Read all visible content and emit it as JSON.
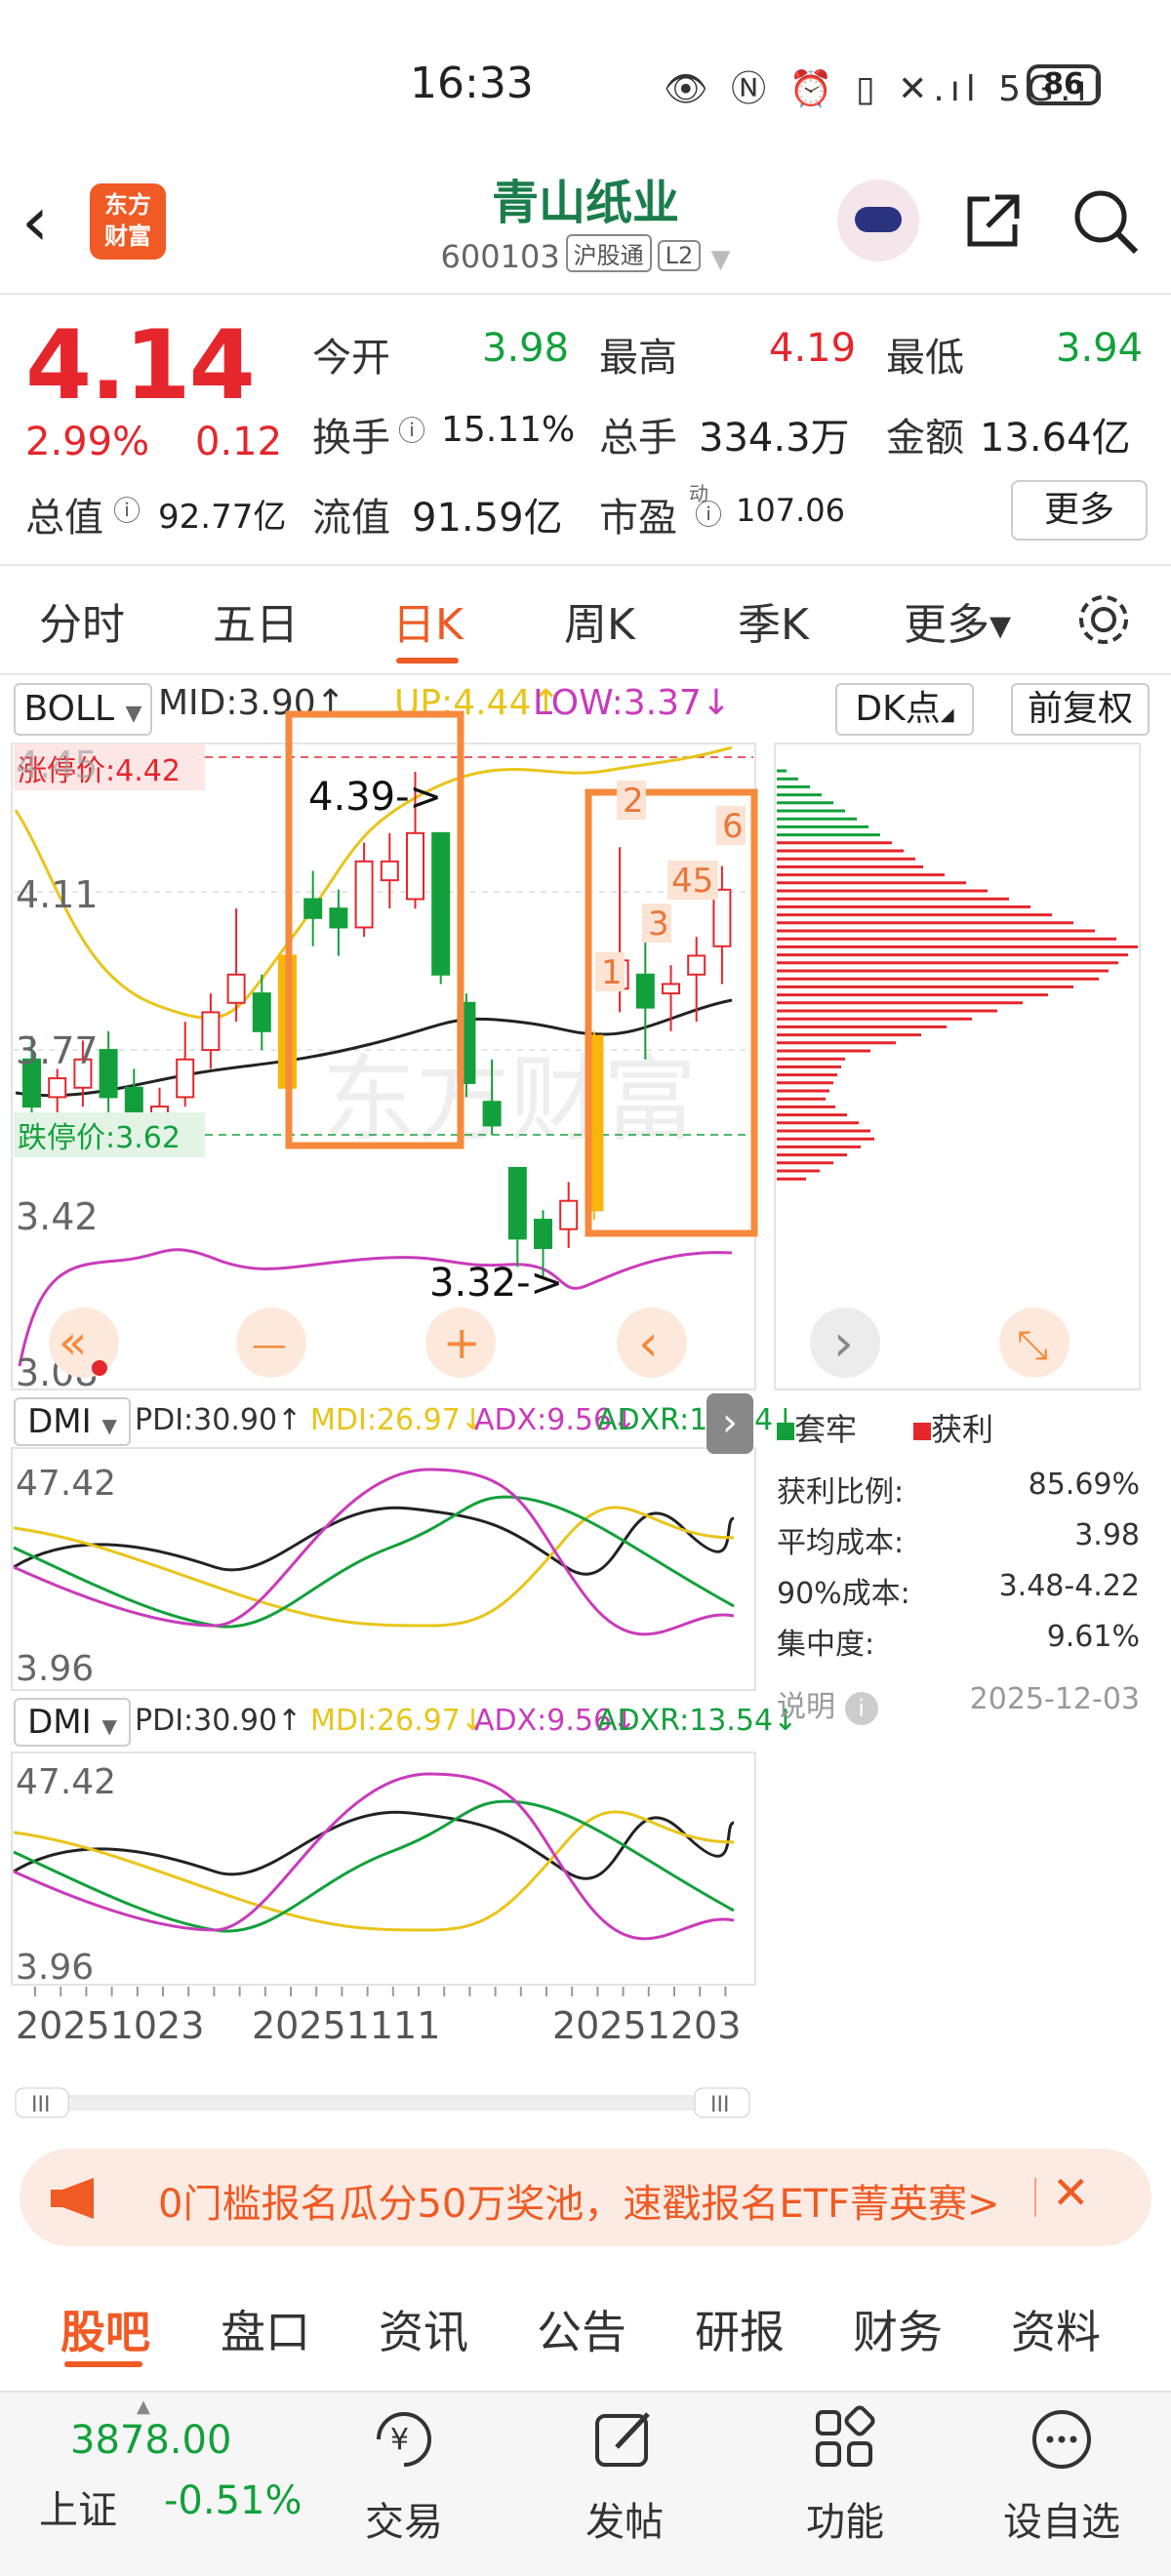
{
  "status_bar": {
    "time": "16:33",
    "battery": "86"
  },
  "header": {
    "logo_line1": "东方",
    "logo_line2": "财富",
    "stock_name": "青山纸业",
    "stock_code": "600103",
    "tag_exchange": "沪股通",
    "tag_level": "L2"
  },
  "quote": {
    "price": "4.14",
    "change_pct": "2.99%",
    "change": "0.12",
    "open_label": "今开",
    "open": "3.98",
    "high_label": "最高",
    "high": "4.19",
    "low_label": "最低",
    "low": "3.94",
    "turnover_label": "换手",
    "turnover": "15.11%",
    "volume_label": "总手",
    "volume": "334.3万",
    "amount_label": "金额",
    "amount": "13.64亿",
    "mktcap_label": "总值",
    "mktcap": "92.77亿",
    "float_label": "流值",
    "float_cap": "91.59亿",
    "pe_label": "市盈",
    "pe_sup": "动",
    "pe": "107.06",
    "more": "更多"
  },
  "period_tabs": [
    "分时",
    "五日",
    "日K",
    "周K",
    "季K",
    "更多▾"
  ],
  "active_period": "日K",
  "main_chart": {
    "indicator": "BOLL",
    "mid": "MID:3.90↑",
    "up": "UP:4.44↑",
    "low": "LOW:3.37↓",
    "dk_button": "DK点",
    "adjust_button": "前复权",
    "limit_up": "涨停价:4.42",
    "limit_down": "跌停价:3.62",
    "y_labels": [
      "4.45",
      "4.11",
      "3.77",
      "3.42",
      "3.08"
    ],
    "annotations": [
      "4.39->",
      "3.32->",
      "1",
      "2",
      "3",
      "45",
      "6"
    ],
    "x_labels": [
      "20251023",
      "20251111",
      "20251203"
    ]
  },
  "chart_data": {
    "type": "candlestick",
    "title": "青山纸业 日K",
    "y_range": [
      3.08,
      4.45
    ],
    "candles": [
      {
        "o": 3.78,
        "c": 3.68,
        "h": 3.83,
        "l": 3.6
      },
      {
        "o": 3.7,
        "c": 3.74,
        "h": 3.76,
        "l": 3.66
      },
      {
        "o": 3.72,
        "c": 3.78,
        "h": 3.82,
        "l": 3.68
      },
      {
        "o": 3.8,
        "c": 3.7,
        "h": 3.84,
        "l": 3.66
      },
      {
        "o": 3.72,
        "c": 3.62,
        "h": 3.76,
        "l": 3.58
      },
      {
        "o": 3.63,
        "c": 3.68,
        "h": 3.72,
        "l": 3.58
      },
      {
        "o": 3.7,
        "c": 3.78,
        "h": 3.86,
        "l": 3.68
      },
      {
        "o": 3.8,
        "c": 3.88,
        "h": 3.92,
        "l": 3.76
      },
      {
        "o": 3.9,
        "c": 3.96,
        "h": 4.1,
        "l": 3.86
      },
      {
        "o": 3.92,
        "c": 3.84,
        "h": 3.96,
        "l": 3.8
      },
      {
        "o": 3.72,
        "c": 4.0,
        "h": 4.02,
        "l": 3.7
      },
      {
        "o": 4.12,
        "c": 4.08,
        "h": 4.18,
        "l": 4.02
      },
      {
        "o": 4.1,
        "c": 4.06,
        "h": 4.14,
        "l": 4.0
      },
      {
        "o": 4.06,
        "c": 4.2,
        "h": 4.24,
        "l": 4.04
      },
      {
        "o": 4.16,
        "c": 4.2,
        "h": 4.26,
        "l": 4.1
      },
      {
        "o": 4.12,
        "c": 4.26,
        "h": 4.39,
        "l": 4.1
      },
      {
        "o": 4.26,
        "c": 3.96,
        "h": 4.26,
        "l": 3.94
      },
      {
        "o": 3.9,
        "c": 3.73,
        "h": 3.92,
        "l": 3.7
      },
      {
        "o": 3.69,
        "c": 3.64,
        "h": 3.78,
        "l": 3.62
      },
      {
        "o": 3.55,
        "c": 3.4,
        "h": 3.55,
        "l": 3.34
      },
      {
        "o": 3.44,
        "c": 3.38,
        "h": 3.46,
        "l": 3.32
      },
      {
        "o": 3.42,
        "c": 3.48,
        "h": 3.52,
        "l": 3.38
      },
      {
        "o": 3.46,
        "c": 3.83,
        "h": 3.84,
        "l": 3.44
      },
      {
        "o": 3.93,
        "c": 3.99,
        "h": 4.23,
        "l": 3.88
      },
      {
        "o": 3.96,
        "c": 3.89,
        "h": 4.04,
        "l": 3.78
      },
      {
        "o": 3.92,
        "c": 3.94,
        "h": 3.98,
        "l": 3.84
      },
      {
        "o": 3.96,
        "c": 4.0,
        "h": 4.04,
        "l": 3.86
      },
      {
        "o": 4.02,
        "c": 4.14,
        "h": 4.19,
        "l": 3.94
      }
    ],
    "highlight_colors": {
      "up": "#e5262c",
      "down": "#13a03c",
      "signal": "#f9b50a",
      "mid": "#222222",
      "upper": "#e8c51a",
      "lower": "#c93bbb"
    }
  },
  "chart_nav": {
    "fast_back": "«",
    "zoom_out": "—",
    "zoom_in": "+",
    "prev": "‹",
    "next": "›",
    "expand": "⤡"
  },
  "dmi_panels": [
    {
      "name": "DMI",
      "pdi": "PDI:30.90↑",
      "mdi": "MDI:26.97↓",
      "adx": "ADX:9.56↓",
      "adxr": "ADXR:13.54↓",
      "top": "47.42",
      "bottom": "3.96"
    },
    {
      "name": "DMI",
      "pdi": "PDI:30.90↑",
      "mdi": "MDI:26.97↓",
      "adx": "ADX:9.56↓",
      "adxr": "ADXR:13.54↓",
      "top": "47.42",
      "bottom": "3.96"
    }
  ],
  "chip_panel": {
    "legend_trapped": "套牢",
    "legend_profit": "获利",
    "profit_ratio_label": "获利比例:",
    "profit_ratio": "85.69%",
    "avg_cost_label": "平均成本:",
    "avg_cost": "3.98",
    "cost90_label": "90%成本:",
    "cost90": "3.48-4.22",
    "concentration_label": "集中度:",
    "concentration": "9.61%",
    "note_label": "说明",
    "date": "2025-12-03"
  },
  "banner": {
    "text": "0门槛报名瓜分50万奖池，速戳报名ETF菁英赛>"
  },
  "bottom_tabs": [
    "股吧",
    "盘口",
    "资讯",
    "公告",
    "研报",
    "财务",
    "资料"
  ],
  "bottom_nav": {
    "index_value": "3878.00",
    "index_name": "上证",
    "index_change": "-0.51%",
    "trade": "交易",
    "post": "发帖",
    "features": "功能",
    "watchlist": "设自选"
  }
}
